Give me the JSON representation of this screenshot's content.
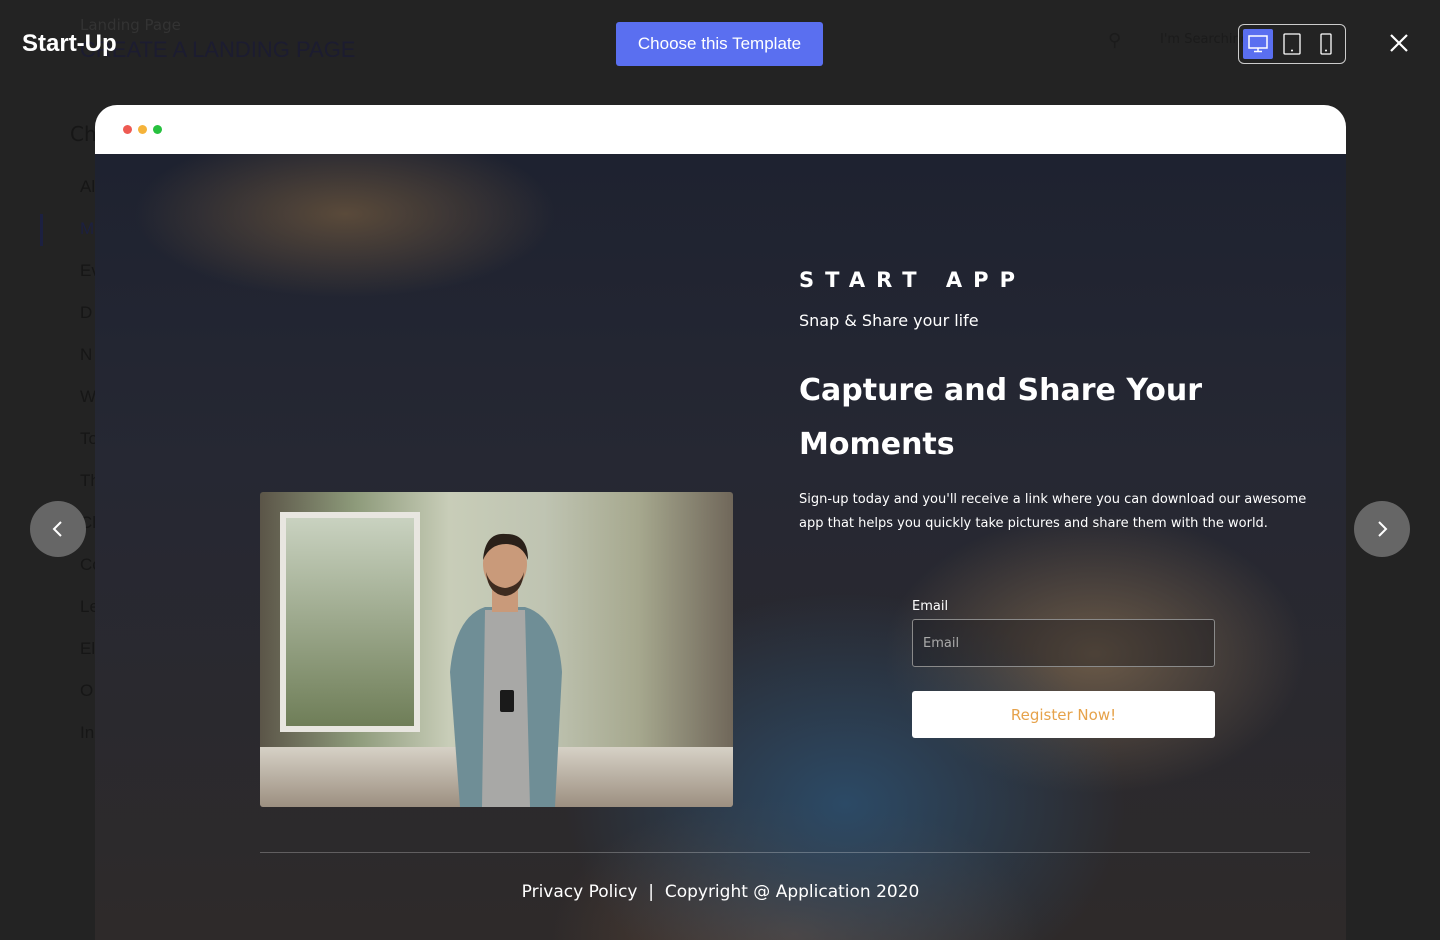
{
  "background": {
    "crumb": "Landing Page",
    "title": "CREATE A LANDING PAGE",
    "category_heading": "Ch",
    "category_fragments": [
      "Al",
      "M",
      "Ev",
      "D",
      "N",
      "W",
      "To",
      "Th",
      "Cl",
      "Co",
      "Le",
      "El",
      "O",
      "In"
    ],
    "search_placeholder": "I'm Searching"
  },
  "header": {
    "title": "Start-Up",
    "choose_label": "Choose this Template",
    "devices": [
      {
        "icon": "desktop-icon",
        "active": true
      },
      {
        "icon": "tablet-icon",
        "active": false
      },
      {
        "icon": "mobile-icon",
        "active": false
      }
    ],
    "close_icon": "close-icon"
  },
  "colors": {
    "accent": "#5a6ff0",
    "register_text": "#e6a24a",
    "dots": [
      "#ee5a52",
      "#f5b33a",
      "#27c13f"
    ]
  },
  "preview": {
    "brand": "START APP",
    "tagline": "Snap & Share your life",
    "headline": "Capture and Share Your Moments",
    "description": "Sign-up today and you'll receive a link where you can download our awesome app that helps you quickly take pictures and share them with the world.",
    "email_label": "Email",
    "email_placeholder": "Email",
    "email_value": "",
    "register_label": "Register Now!",
    "footer": "Privacy Policy  |  Copyright @ Application 2020"
  },
  "nav": {
    "prev_icon": "chevron-left-icon",
    "next_icon": "chevron-right-icon"
  }
}
